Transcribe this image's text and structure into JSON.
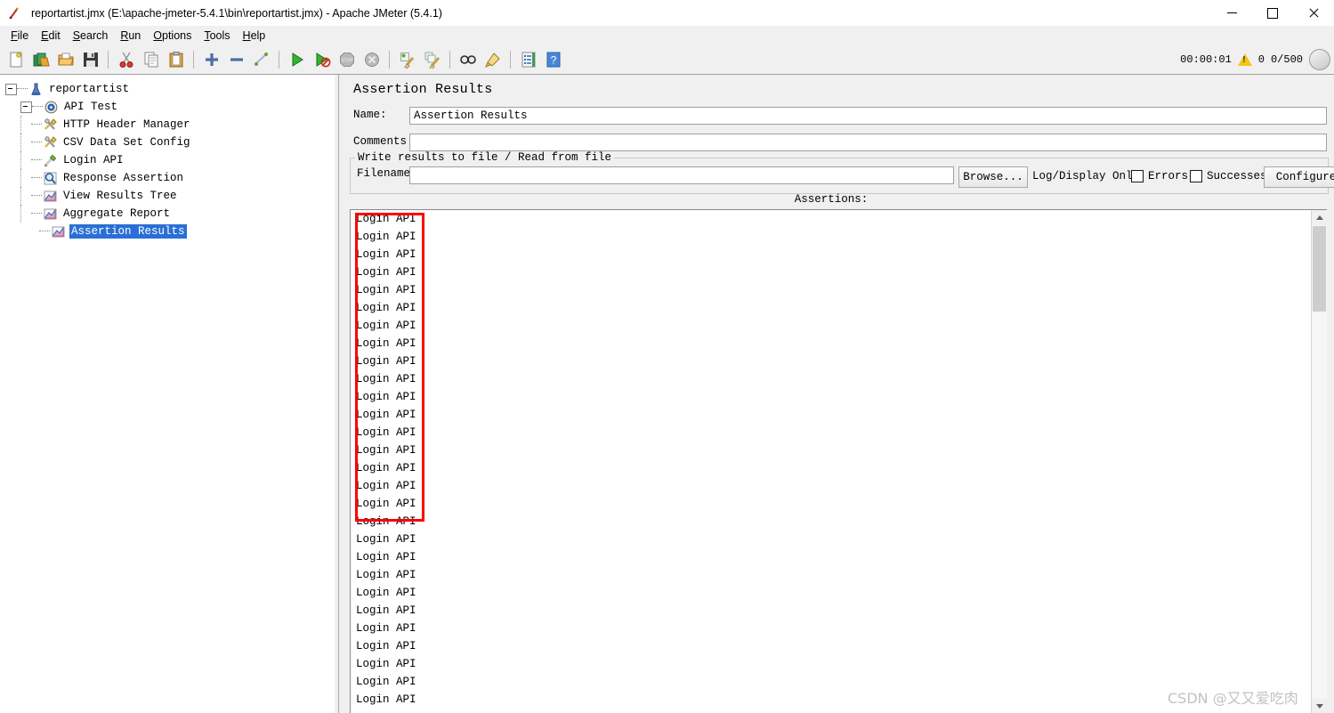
{
  "window": {
    "title": "reportartist.jmx (E:\\apache-jmeter-5.4.1\\bin\\reportartist.jmx) - Apache JMeter (5.4.1)",
    "app_icon": "jmeter-feather-icon",
    "controls": {
      "minimize": "minimize-icon",
      "maximize": "maximize-icon",
      "close": "close-icon"
    }
  },
  "menubar": {
    "items": [
      {
        "label": "File",
        "mnemonic": "F"
      },
      {
        "label": "Edit",
        "mnemonic": "E"
      },
      {
        "label": "Search",
        "mnemonic": "S"
      },
      {
        "label": "Run",
        "mnemonic": "R"
      },
      {
        "label": "Options",
        "mnemonic": "O"
      },
      {
        "label": "Tools",
        "mnemonic": "T"
      },
      {
        "label": "Help",
        "mnemonic": "H"
      }
    ]
  },
  "toolbar": {
    "buttons": [
      {
        "name": "new-icon",
        "title": "New"
      },
      {
        "name": "templates-icon",
        "title": "Templates"
      },
      {
        "name": "open-icon",
        "title": "Open"
      },
      {
        "name": "save-icon",
        "title": "Save"
      },
      {
        "sep": true
      },
      {
        "name": "cut-icon",
        "title": "Cut"
      },
      {
        "name": "copy-icon",
        "title": "Copy"
      },
      {
        "name": "paste-icon",
        "title": "Paste"
      },
      {
        "sep": true
      },
      {
        "name": "expand-all-icon",
        "title": "Expand All"
      },
      {
        "name": "collapse-all-icon",
        "title": "Collapse All"
      },
      {
        "name": "toggle-icon",
        "title": "Toggle"
      },
      {
        "sep": true
      },
      {
        "name": "start-icon",
        "title": "Start"
      },
      {
        "name": "start-no-timers-icon",
        "title": "Start no pauses"
      },
      {
        "name": "stop-icon",
        "title": "Stop"
      },
      {
        "name": "shutdown-icon",
        "title": "Shutdown"
      },
      {
        "sep": true
      },
      {
        "name": "clear-icon",
        "title": "Clear"
      },
      {
        "name": "clear-all-icon",
        "title": "Clear All"
      },
      {
        "sep": true
      },
      {
        "name": "search-icon",
        "title": "Search"
      },
      {
        "name": "search-reset-icon",
        "title": "Reset Search"
      },
      {
        "sep": true
      },
      {
        "name": "function-helper-icon",
        "title": "Function Helper Dialog"
      },
      {
        "name": "help-icon",
        "title": "Help"
      }
    ],
    "status": {
      "elapsed_time": "00:00:01",
      "warning_icon": "warning-triangle-icon",
      "warning_count": "0",
      "threads": "0/500",
      "thread_indicator": "thread-status-circle"
    }
  },
  "tree": {
    "nodes": [
      {
        "label": "reportartist",
        "icon": "test-plan-icon",
        "depth": 0,
        "toggle": true,
        "selected": false
      },
      {
        "label": "API Test",
        "icon": "thread-group-icon",
        "depth": 1,
        "toggle": true,
        "selected": false
      },
      {
        "label": "HTTP Header Manager",
        "icon": "config-element-icon",
        "depth": 2,
        "toggle": false,
        "selected": false
      },
      {
        "label": "CSV Data Set Config",
        "icon": "config-element-icon",
        "depth": 2,
        "toggle": false,
        "selected": false
      },
      {
        "label": "Login API",
        "icon": "http-sampler-icon",
        "depth": 2,
        "toggle": false,
        "selected": false
      },
      {
        "label": "Response Assertion",
        "icon": "assertion-icon",
        "depth": 2,
        "toggle": false,
        "selected": false
      },
      {
        "label": "View Results Tree",
        "icon": "listener-icon",
        "depth": 2,
        "toggle": false,
        "selected": false
      },
      {
        "label": "Aggregate Report",
        "icon": "listener-icon",
        "depth": 2,
        "toggle": false,
        "selected": false
      },
      {
        "label": "Assertion Results",
        "icon": "listener-icon",
        "depth": 2,
        "toggle": false,
        "selected": true
      }
    ]
  },
  "panel": {
    "title": "Assertion Results",
    "name_label": "Name:",
    "name_value": "Assertion Results",
    "comments_label": "Comments:",
    "comments_value": "",
    "file_group_legend": "Write results to file / Read from file",
    "filename_label": "Filename",
    "filename_value": "",
    "browse_label": "Browse...",
    "log_display_label": "Log/Display Only:",
    "errors_label": "Errors",
    "errors_checked": false,
    "successes_label": "Successes",
    "successes_checked": false,
    "configure_label": "Configure",
    "assertions_label": "Assertions:"
  },
  "results": {
    "rows": [
      "Login API",
      "Login API",
      "Login API",
      "Login API",
      "Login API",
      "Login API",
      "Login API",
      "Login API",
      "Login API",
      "Login API",
      "Login API",
      "Login API",
      "Login API",
      "Login API",
      "Login API",
      "Login API",
      "Login API",
      "Login API",
      "Login API",
      "Login API",
      "Login API",
      "Login API",
      "Login API",
      "Login API",
      "Login API",
      "Login API",
      "Login API",
      "Login API"
    ]
  },
  "annotation": {
    "highlight_color": "#ff0000",
    "highlight_rows": 17
  },
  "watermark": {
    "text": "CSDN @又又爱吃肉"
  }
}
